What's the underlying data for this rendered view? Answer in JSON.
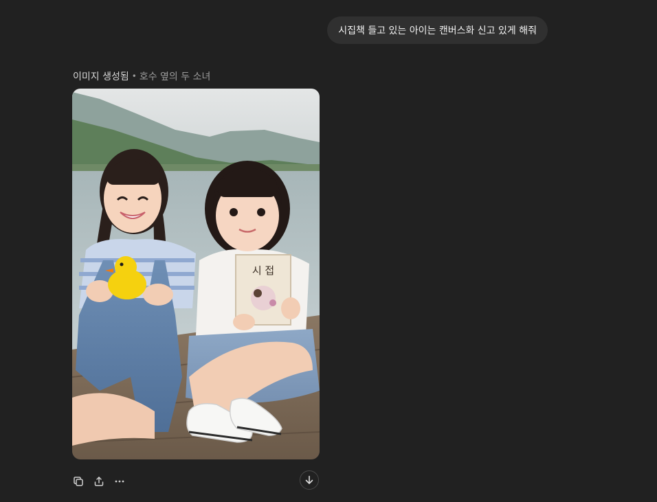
{
  "conversation": {
    "user_message": "시집책 들고 있는 아이는 캔버스화 신고 있게 해줘",
    "assistant": {
      "status": "이미지 생성됨",
      "separator": "•",
      "image_title": "호수 옆의 두 소녀",
      "image": {
        "description_icon": "generated-photo",
        "book_text": "시 접"
      }
    }
  },
  "actions": {
    "icons": [
      "copy-icon",
      "share-icon",
      "more-icon",
      "download-icon"
    ]
  },
  "colors": {
    "background": "#212121",
    "bubble": "#303030",
    "text_primary": "#ececec",
    "text_secondary": "#9b9b9b"
  }
}
